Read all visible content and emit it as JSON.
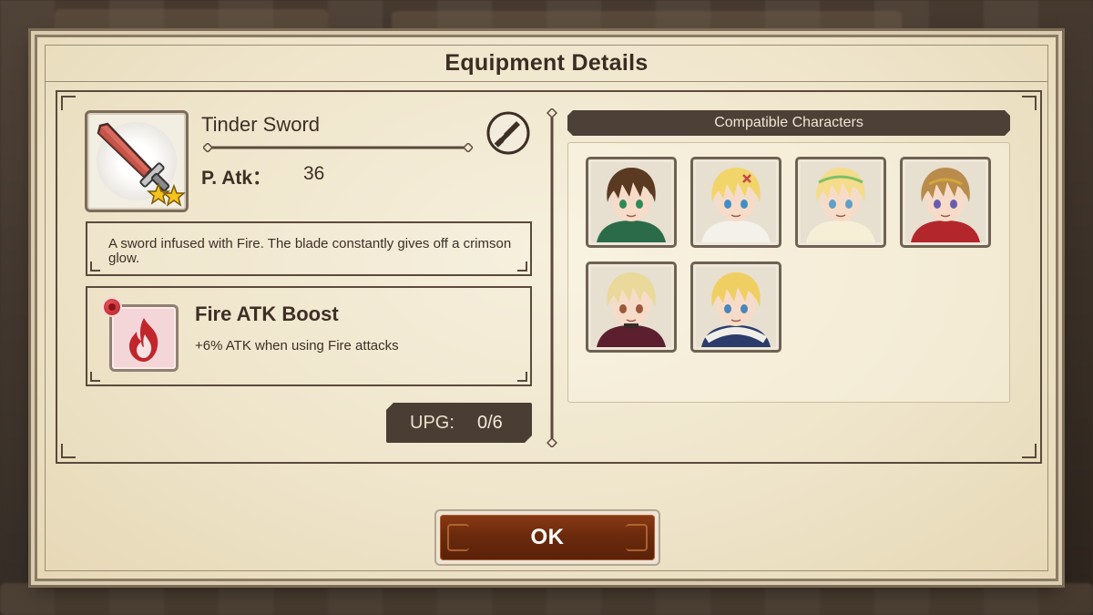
{
  "dialog": {
    "title": "Equipment Details",
    "ok_label": "OK"
  },
  "item": {
    "name": "Tinder Sword",
    "rarity_stars": 2,
    "icon": "sword-icon",
    "type_icon": "dagger-type-icon",
    "stat_label": "P. Atk：",
    "stat_value": "36",
    "description": "A sword infused with Fire. The blade constantly gives off a crimson glow."
  },
  "skill": {
    "name": "Fire ATK Boost",
    "description": "+6% ATK when using Fire attacks",
    "icon": "fire-icon",
    "accent_color": "#c0262c"
  },
  "upgrade": {
    "label": "UPG:",
    "value": "0/6"
  },
  "compatible": {
    "header": "Compatible Characters",
    "characters": [
      {
        "hair": "#5b3a22",
        "eyes": "#2f8a5a",
        "outfit": "#2b6b4a",
        "accessory": "none"
      },
      {
        "hair": "#f2d56a",
        "eyes": "#3f8fc6",
        "outfit": "#f4f1ea",
        "accessory": "hairpin"
      },
      {
        "hair": "#f4dc8a",
        "eyes": "#5f9fc8",
        "outfit": "#f6efd6",
        "accessory": "leaf-crown"
      },
      {
        "hair": "#b98c4c",
        "eyes": "#6b5bb0",
        "outfit": "#b3272c",
        "accessory": "circlet"
      },
      {
        "hair": "#e9d99a",
        "eyes": "#9a5a3a",
        "outfit": "#5b1f2e",
        "accessory": "collar"
      },
      {
        "hair": "#f0cf62",
        "eyes": "#4a86b8",
        "outfit": "#2c3c6a",
        "accessory": "fur-collar"
      }
    ]
  },
  "colors": {
    "parchment": "#f2e9d2",
    "frame": "#5a4a3c",
    "ok_button": "#6b2a0d",
    "upg_box": "#4a3e34"
  }
}
